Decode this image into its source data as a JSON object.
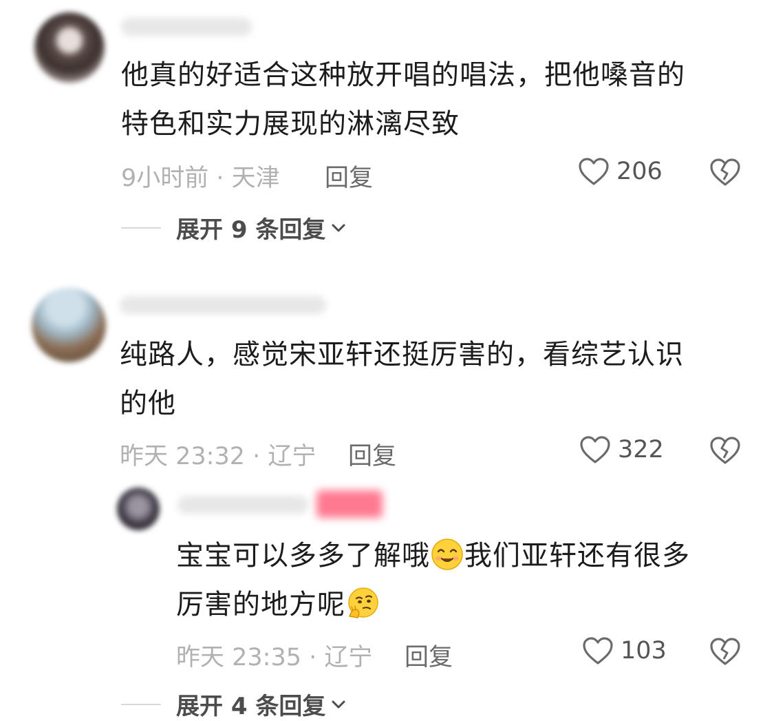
{
  "comments": [
    {
      "text_line1": "他真的好适合这种放开唱的唱法，把他嗓音的",
      "text_line2": "特色和实力展现的淋漓尽致",
      "meta": "9小时前 · 天津",
      "reply_label": "回复",
      "likes": "206",
      "expand_label": "展开 9 条回复"
    },
    {
      "text_line1": "纯路人，感觉宋亚轩还挺厉害的，看综艺认识",
      "text_line2": "的他",
      "meta": "昨天 23:32 · 辽宁",
      "reply_label": "回复",
      "likes": "322"
    }
  ],
  "sub_reply": {
    "text_line1_a": "宝宝可以多多了解哦",
    "text_line1_emoji": "smiling-face-icon",
    "text_line1_b": "我们亚轩还有很多",
    "text_line2": "厉害的地方呢",
    "text_line2_emoji": "thinking-sly-face-icon",
    "meta": "昨天 23:35 · 辽宁",
    "reply_label": "回复",
    "likes": "103",
    "expand_label": "展开 4 条回复"
  },
  "icons": {
    "like": "heart-outline-icon",
    "dislike": "broken-heart-icon",
    "expand": "chevron-down-icon"
  },
  "colors": {
    "text": "#1c1c1c",
    "meta": "#b1b1b1",
    "reply": "#6a6a6a",
    "badge": "#ff6b84"
  }
}
